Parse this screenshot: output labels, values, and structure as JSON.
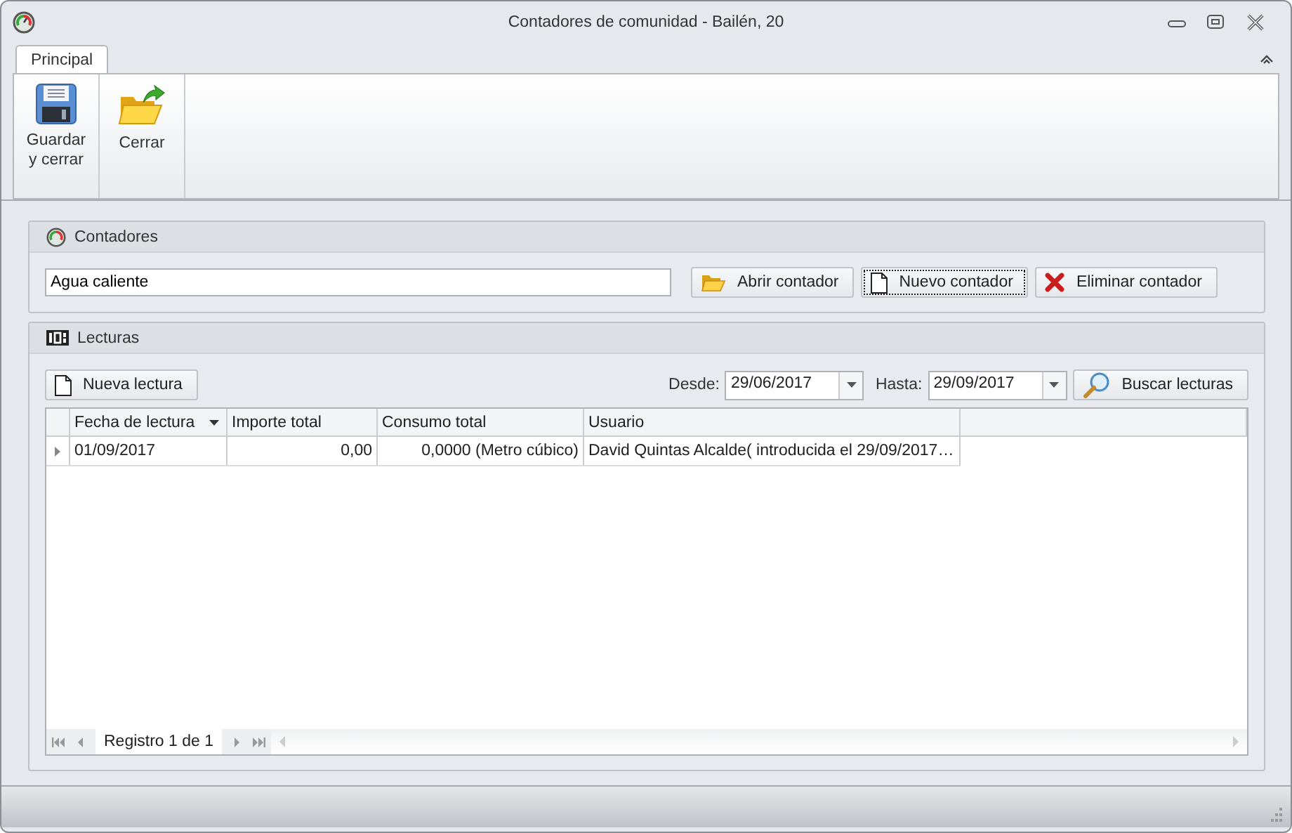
{
  "window": {
    "title": "Contadores de comunidad - Bailén, 20"
  },
  "tabs": [
    {
      "label": "Principal",
      "selected": true
    }
  ],
  "ribbon": {
    "buttons": [
      {
        "label": "Guardar y cerrar",
        "kind": "save"
      },
      {
        "label": "Cerrar",
        "kind": "close-folder"
      }
    ]
  },
  "contadores": {
    "title": "Contadores",
    "field": {
      "value": "Agua caliente"
    },
    "buttons": [
      {
        "label": "Abrir contador",
        "kind": "open",
        "focused": false
      },
      {
        "label": "Nuevo contador",
        "kind": "new",
        "focused": true
      },
      {
        "label": "Eliminar contador",
        "kind": "delete",
        "focused": false
      }
    ]
  },
  "lecturas": {
    "title": "Lecturas",
    "new_button": {
      "label": "Nueva lectura",
      "kind": "new"
    },
    "from": {
      "label": "Desde:",
      "value": "29/06/2017"
    },
    "to": {
      "label": "Hasta:",
      "value": "29/09/2017"
    },
    "search_button": {
      "label": "Buscar lecturas",
      "kind": "search"
    },
    "table": {
      "columns": [
        {
          "label": "Fecha de lectura",
          "sorted": true
        },
        {
          "label": "Importe total",
          "sorted": false
        },
        {
          "label": "Consumo total",
          "sorted": false
        },
        {
          "label": "Usuario",
          "sorted": false
        }
      ],
      "rows": [
        {
          "selected": true,
          "cells": [
            "01/09/2017",
            "0,00",
            "0,0000 (Metro cúbico)",
            "David Quintas Alcalde( introducida el 29/09/2017…"
          ]
        }
      ]
    },
    "navigator": "Registro 1 de 1"
  }
}
